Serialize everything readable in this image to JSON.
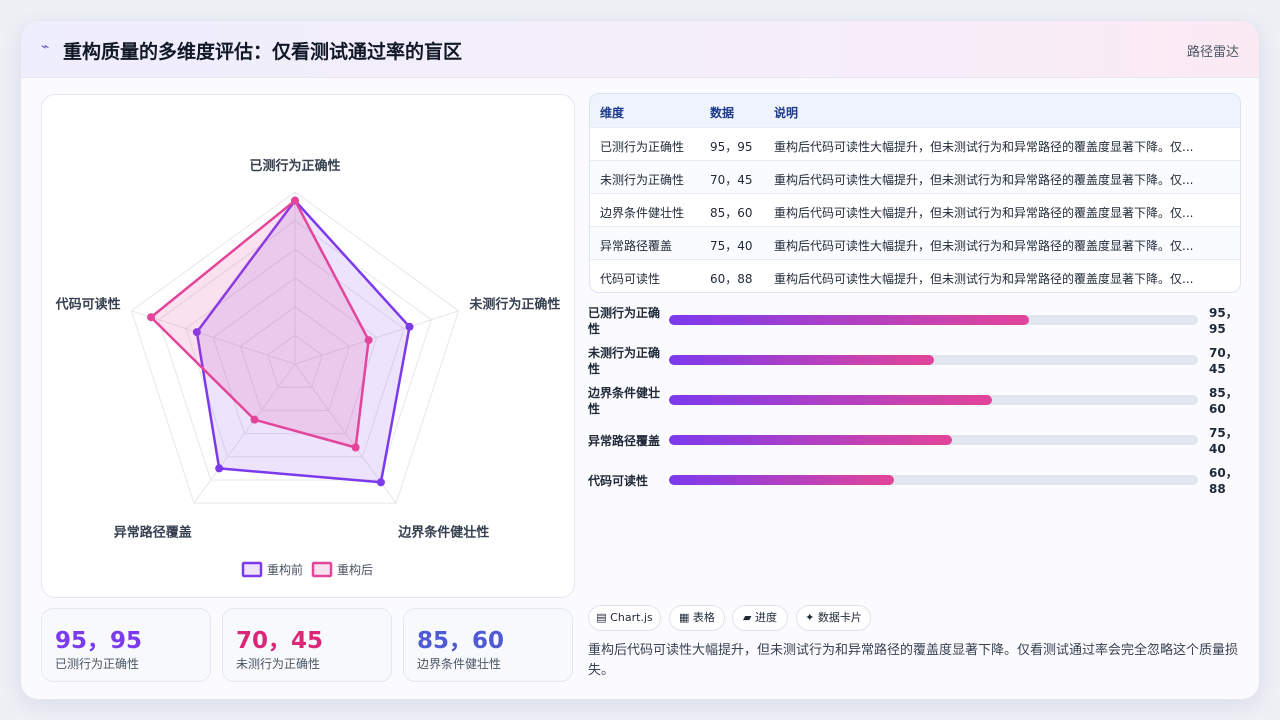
{
  "header": {
    "logo_icon": "pulse-icon",
    "logo_glyph": "⌁",
    "title": "重构质量的多维度评估：仅看测试通过率的盲区",
    "nav": "路径雷达"
  },
  "chart_data": {
    "type": "radar",
    "categories": [
      "已测行为正确性",
      "未测行为正确性",
      "边界条件健壮性",
      "异常路径覆盖",
      "代码可读性"
    ],
    "rmax": 100,
    "series": [
      {
        "name": "重构前",
        "values": [
          95,
          70,
          85,
          75,
          60
        ],
        "color": "#7c3aed"
      },
      {
        "name": "重构后",
        "values": [
          95,
          45,
          60,
          40,
          88
        ],
        "color": "#e2459a"
      }
    ]
  },
  "stats": [
    {
      "value": "95，95",
      "label": "已测行为正确性",
      "color": "#7c3aed"
    },
    {
      "value": "70，45",
      "label": "未测行为正确性",
      "color": "#db2777"
    },
    {
      "value": "85，60",
      "label": "边界条件健壮性",
      "color": "#4f5bd5"
    }
  ],
  "table": {
    "headers": [
      "维度",
      "数据",
      "说明"
    ],
    "rows": [
      [
        "已测行为正确性",
        "95，95",
        "重构后代码可读性大幅提升，但未测试行为和异常路径的覆盖度显著下降。仅..."
      ],
      [
        "未测行为正确性",
        "70，45",
        "重构后代码可读性大幅提升，但未测试行为和异常路径的覆盖度显著下降。仅..."
      ],
      [
        "边界条件健壮性",
        "85，60",
        "重构后代码可读性大幅提升，但未测试行为和异常路径的覆盖度显著下降。仅..."
      ],
      [
        "异常路径覆盖",
        "75，40",
        "重构后代码可读性大幅提升，但未测试行为和异常路径的覆盖度显著下降。仅..."
      ],
      [
        "代码可读性",
        "60，88",
        "重构后代码可读性大幅提升，但未测试行为和异常路径的覆盖度显著下降。仅..."
      ]
    ]
  },
  "bars": [
    {
      "label": "已测行为正确性",
      "value": "95，95",
      "fraction": 0.68
    },
    {
      "label": "未测行为正确性",
      "value": "70，45",
      "fraction": 0.5
    },
    {
      "label": "边界条件健壮性",
      "value": "85，60",
      "fraction": 0.61
    },
    {
      "label": "异常路径覆盖",
      "value": "75，40",
      "fraction": 0.535
    },
    {
      "label": "代码可读性",
      "value": "60，88",
      "fraction": 0.425
    }
  ],
  "chips": [
    "▤ Chart.js",
    "▦ 表格",
    "▰ 进度",
    "✦ 数据卡片"
  ],
  "summary": "重构后代码可读性大幅提升，但未测试行为和异常路径的覆盖度显著下降。仅看测试通过率会完全忽略这个质量损失。"
}
